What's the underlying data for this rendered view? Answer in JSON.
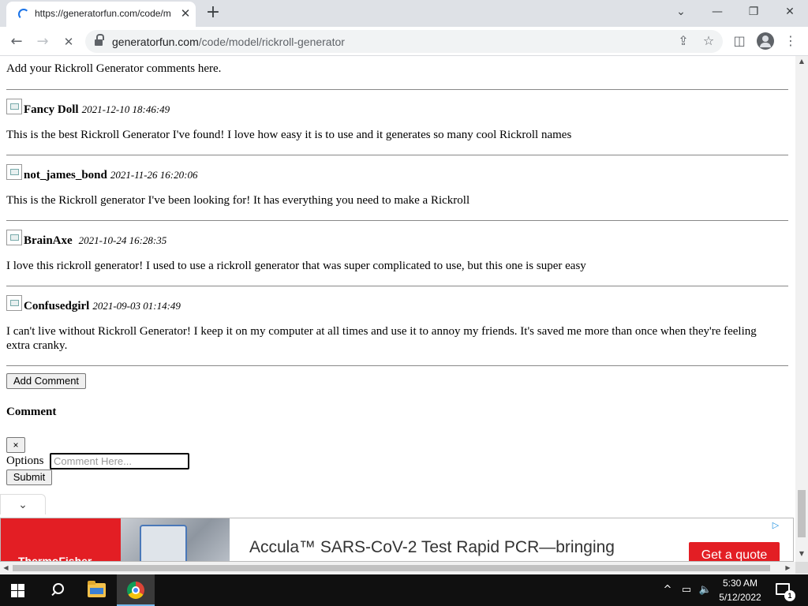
{
  "browser": {
    "tab_title": "https://generatorfun.com/code/m",
    "url_domain": "generatorfun.com",
    "url_path": "/code/model/rickroll-generator",
    "icons": [
      "back-icon",
      "forward-icon",
      "stop-loading-icon",
      "lock-icon",
      "share-icon",
      "star-icon",
      "side-panel-icon",
      "profile-icon",
      "menu-icon"
    ]
  },
  "page": {
    "intro": "Add your Rickroll Generator comments here.",
    "comments": [
      {
        "author": "Fancy Doll",
        "date": "2021-12-10 18:46:49",
        "text": "This is the best Rickroll Generator I've found! I love how easy it is to use and it generates so many cool Rickroll names"
      },
      {
        "author": "not_james_bond",
        "date": "2021-11-26 16:20:06",
        "text": "This is the Rickroll generator I've been looking for! It has everything you need to make a Rickroll"
      },
      {
        "author": "BrainAxe",
        "date": "2021-10-24 16:28:35",
        "text": "I love this rickroll generator! I used to use a rickroll generator that was super complicated to use, but this one is super easy"
      },
      {
        "author": "Confusedgirl",
        "date": "2021-09-03 01:14:49",
        "text": "I can't live without Rickroll Generator! I keep it on my computer at all times and use it to annoy my friends. It's saved me more than once when they're feeling extra cranky."
      }
    ],
    "add_comment_label": "Add Comment",
    "form": {
      "title": "Comment",
      "close_label": "×",
      "options_label": "Options",
      "input_placeholder": "Comment Here...",
      "input_value": "",
      "submit_label": "Submit"
    }
  },
  "ad": {
    "headline": "Accula™ SARS-CoV-2 Test Rapid PCR—bringing",
    "brand": "ThermoFisher",
    "cta": "Get a quote",
    "accent_color": "#e31e24"
  },
  "taskbar": {
    "time": "5:30 AM",
    "date": "5/12/2022",
    "notification_count": "1"
  }
}
